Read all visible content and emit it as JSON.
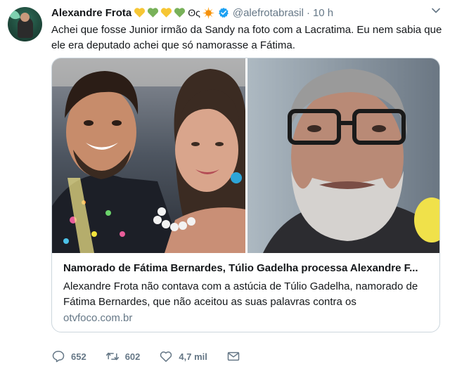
{
  "author": {
    "display_name": "Alexandre Frota",
    "ot_text": "ʘς",
    "handle": "@alefrotabrasil",
    "separator": "·",
    "time": "10 h"
  },
  "tweet": {
    "text": "Achei que fosse Junior irmão da Sandy na foto com a Lacratima. Eu nem sabia que ele era deputado achei que só namorasse a Fátima."
  },
  "card": {
    "title": "Namorado de Fátima Bernardes, Túlio Gadelha processa Alexandre F...",
    "description": "Alexandre Frota não contava com a astúcia de Túlio Gadelha, namorado de Fátima Bernardes, que não aceitou as suas palavras contra os",
    "domain": "otvfoco.com.br"
  },
  "actions": {
    "replies": "652",
    "retweets": "602",
    "likes": "4,7 mil"
  },
  "colors": {
    "heart_yellow": "#f6c634",
    "heart_green": "#78b159",
    "verified_blue": "#1da1f2",
    "secondary_text": "#657786",
    "border": "#ccd6dd"
  }
}
